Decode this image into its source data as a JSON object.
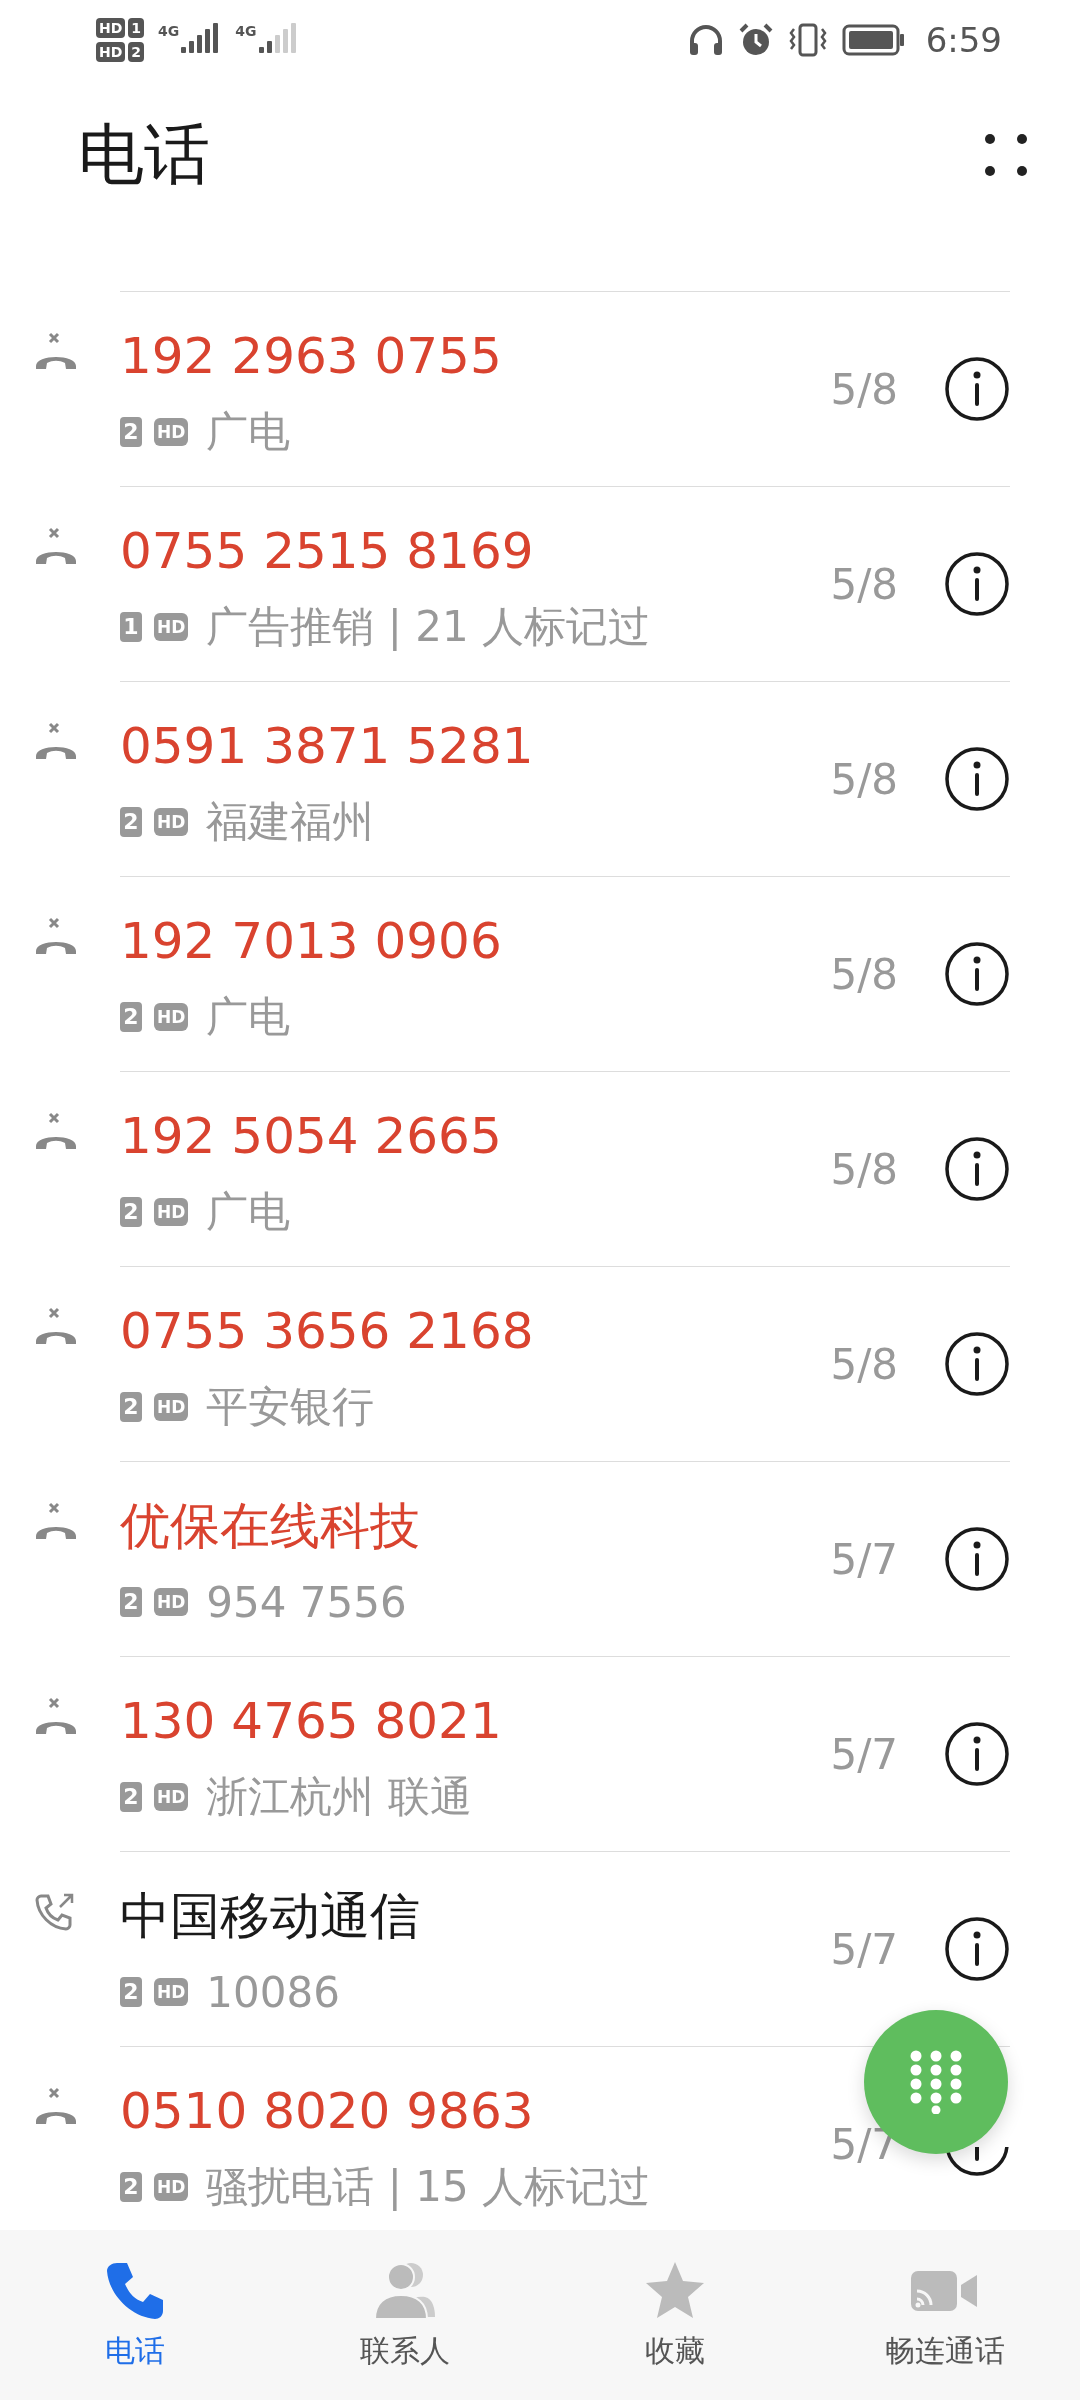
{
  "status_bar": {
    "sim_badges": [
      {
        "hd": "HD",
        "sim": "1"
      },
      {
        "hd": "HD",
        "sim": "2"
      }
    ],
    "networks": [
      {
        "label": "4G"
      },
      {
        "label": "4G"
      }
    ],
    "time": "6:59"
  },
  "header": {
    "title": "电话"
  },
  "calls": [
    {
      "kind": "missed",
      "name": "192 2963 0755",
      "sim": "2",
      "hd": "HD",
      "subtitle": "广电",
      "date": "5/8"
    },
    {
      "kind": "missed",
      "name": "0755 2515 8169",
      "sim": "1",
      "hd": "HD",
      "subtitle": "广告推销 | 21 人标记过",
      "date": "5/8"
    },
    {
      "kind": "missed",
      "name": "0591 3871 5281",
      "sim": "2",
      "hd": "HD",
      "subtitle": "福建福州",
      "date": "5/8"
    },
    {
      "kind": "missed",
      "name": "192 7013 0906",
      "sim": "2",
      "hd": "HD",
      "subtitle": "广电",
      "date": "5/8"
    },
    {
      "kind": "missed",
      "name": "192 5054 2665",
      "sim": "2",
      "hd": "HD",
      "subtitle": "广电",
      "date": "5/8"
    },
    {
      "kind": "missed",
      "name": "0755 3656 2168",
      "sim": "2",
      "hd": "HD",
      "subtitle": "平安银行",
      "date": "5/8"
    },
    {
      "kind": "missed",
      "name": "优保在线科技",
      "sim": "2",
      "hd": "HD",
      "subtitle": "954 7556",
      "date": "5/7"
    },
    {
      "kind": "missed",
      "name": "130 4765 8021",
      "sim": "2",
      "hd": "HD",
      "subtitle": "浙江杭州 联通",
      "date": "5/7"
    },
    {
      "kind": "outgoing",
      "name": "中国移动通信",
      "sim": "2",
      "hd": "HD",
      "subtitle": "10086",
      "date": "5/7"
    },
    {
      "kind": "missed",
      "name": "0510 8020 9863",
      "sim": "2",
      "hd": "HD",
      "subtitle": "骚扰电话 | 15 人标记过",
      "date": "5/7"
    }
  ],
  "tabs": [
    {
      "kind": "phone",
      "label": "电话",
      "selected": true
    },
    {
      "kind": "contacts",
      "label": "联系人",
      "selected": false
    },
    {
      "kind": "favorites",
      "label": "收藏",
      "selected": false
    },
    {
      "kind": "video",
      "label": "畅连通话",
      "selected": false
    }
  ]
}
